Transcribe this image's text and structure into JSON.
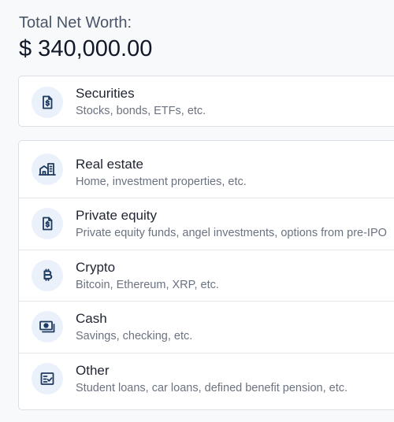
{
  "net_worth": {
    "label": "Total Net Worth:",
    "value": "$ 340,000.00"
  },
  "accent_color": "#1f3a5f",
  "icon_bg_color": "#eaf1fb",
  "asset_groups": [
    {
      "items": [
        {
          "icon": "dollar-document-icon",
          "title": "Securities",
          "subtitle": "Stocks, bonds, ETFs, etc."
        }
      ]
    },
    {
      "items": [
        {
          "icon": "building-icon",
          "title": "Real estate",
          "subtitle": "Home, investment properties, etc."
        },
        {
          "icon": "dollar-document-icon",
          "title": "Private equity",
          "subtitle": "Private equity funds, angel investments, options from pre-IPO"
        },
        {
          "icon": "bitcoin-icon",
          "title": "Crypto",
          "subtitle": "Bitcoin, Ethereum, XRP, etc."
        },
        {
          "icon": "cash-icon",
          "title": "Cash",
          "subtitle": "Savings, checking, etc."
        },
        {
          "icon": "checklist-icon",
          "title": "Other",
          "subtitle": "Student loans, car loans, defined benefit pension, etc."
        }
      ]
    }
  ]
}
